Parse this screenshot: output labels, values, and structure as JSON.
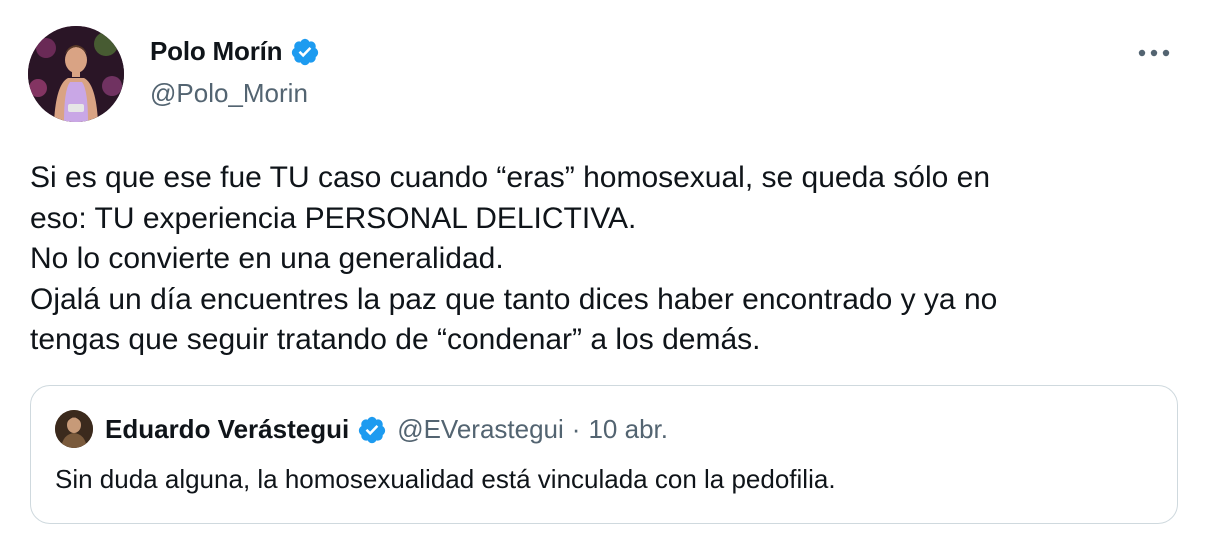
{
  "tweet": {
    "author": {
      "name": "Polo Morín",
      "handle": "@Polo_Morin",
      "verified": true
    },
    "more_icon": "more-horizontal-icon",
    "text_lines": [
      "Si es que ese fue TU caso cuando “eras” homosexual, se queda sólo en",
      "eso: TU experiencia PERSONAL DELICTIVA.",
      "No lo convierte en una generalidad.",
      "Ojalá un día encuentres la paz que tanto dices haber encontrado y ya no",
      "tengas que seguir tratando de “condenar” a los demás."
    ]
  },
  "quote": {
    "author": {
      "name": "Eduardo Verástegui",
      "handle": "@EVerastegui",
      "verified": true
    },
    "separator": "·",
    "date": "10 abr.",
    "text": "Sin duda alguna, la homosexualidad está vinculada con la pedofilia."
  },
  "colors": {
    "text_primary": "#0f1419",
    "text_secondary": "#536471",
    "verified_blue": "#1d9bf0",
    "border": "#cfd9de"
  }
}
